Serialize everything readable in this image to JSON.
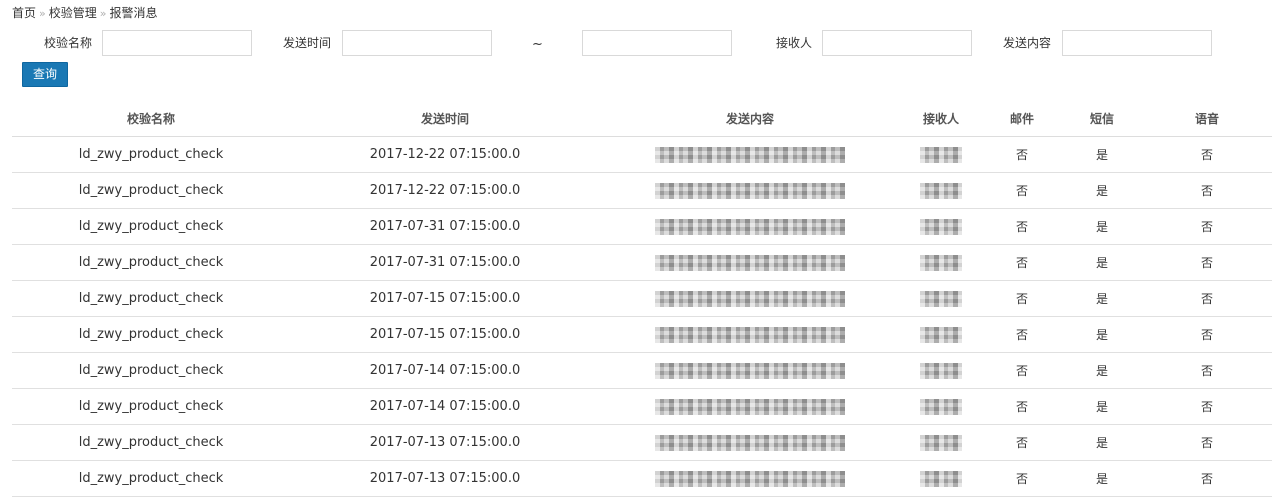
{
  "breadcrumb": {
    "home": "首页",
    "sep": "»",
    "section": "校验管理",
    "current": "报警消息"
  },
  "search": {
    "check_name_label": "校验名称",
    "check_name_value": "",
    "send_time_label": "发送时间",
    "send_time_from": "",
    "range_sep": "~",
    "send_time_to": "",
    "receiver_label": "接收人",
    "receiver_value": "",
    "content_label": "发送内容",
    "content_value": "",
    "query_button": "查询"
  },
  "table": {
    "columns": [
      "校验名称",
      "发送时间",
      "发送内容",
      "接收人",
      "邮件",
      "短信",
      "语音"
    ],
    "rows": [
      {
        "name": "ld_zwy_product_check",
        "time": "2017-12-22 07:15:00.0",
        "email": "否",
        "sms": "是",
        "voice": "否"
      },
      {
        "name": "ld_zwy_product_check",
        "time": "2017-12-22 07:15:00.0",
        "email": "否",
        "sms": "是",
        "voice": "否"
      },
      {
        "name": "ld_zwy_product_check",
        "time": "2017-07-31 07:15:00.0",
        "email": "否",
        "sms": "是",
        "voice": "否"
      },
      {
        "name": "ld_zwy_product_check",
        "time": "2017-07-31 07:15:00.0",
        "email": "否",
        "sms": "是",
        "voice": "否"
      },
      {
        "name": "ld_zwy_product_check",
        "time": "2017-07-15 07:15:00.0",
        "email": "否",
        "sms": "是",
        "voice": "否"
      },
      {
        "name": "ld_zwy_product_check",
        "time": "2017-07-15 07:15:00.0",
        "email": "否",
        "sms": "是",
        "voice": "否"
      },
      {
        "name": "ld_zwy_product_check",
        "time": "2017-07-14 07:15:00.0",
        "email": "否",
        "sms": "是",
        "voice": "否"
      },
      {
        "name": "ld_zwy_product_check",
        "time": "2017-07-14 07:15:00.0",
        "email": "否",
        "sms": "是",
        "voice": "否"
      },
      {
        "name": "ld_zwy_product_check",
        "time": "2017-07-13 07:15:00.0",
        "email": "否",
        "sms": "是",
        "voice": "否"
      },
      {
        "name": "ld_zwy_product_check",
        "time": "2017-07-13 07:15:00.0",
        "email": "否",
        "sms": "是",
        "voice": "否"
      }
    ]
  },
  "colors": {
    "accent": "#1a78b4",
    "border": "#e0e0e0"
  }
}
